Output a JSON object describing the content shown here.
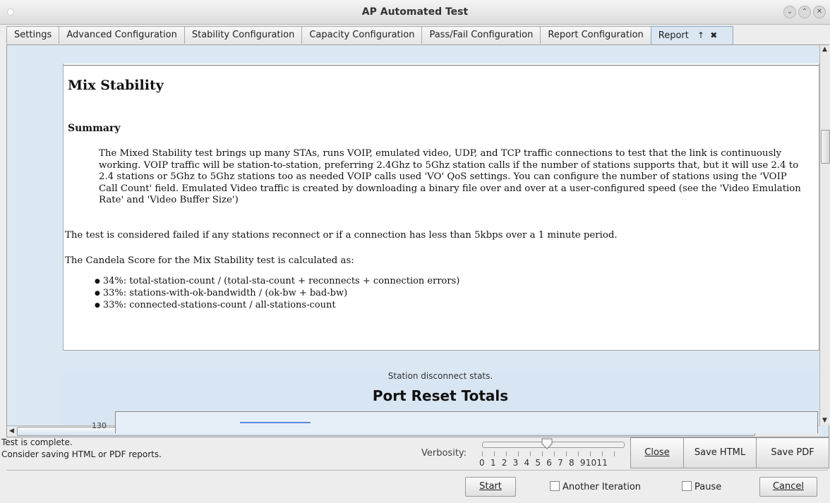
{
  "window": {
    "title": "AP Automated Test"
  },
  "tabs": [
    {
      "label": "Settings"
    },
    {
      "label": "Advanced Configuration"
    },
    {
      "label": "Stability Configuration"
    },
    {
      "label": "Capacity Configuration"
    },
    {
      "label": "Pass/Fail Configuration"
    },
    {
      "label": "Report Configuration"
    },
    {
      "label": "Report",
      "icons": [
        "up-arrow-icon",
        "close-icon"
      ]
    }
  ],
  "report": {
    "heading": "Mix Stability",
    "subheading": "Summary",
    "summary": "The Mixed Stability test brings up many STAs, runs VOIP, emulated video, UDP, and TCP traffic connections to test that the link is continuously working. VOIP traffic will be station-to-station, preferring 2.4Ghz to 5Ghz station calls if the number of stations supports that, but it will use 2.4 to 2.4 stations or 5Ghz to 5Ghz stations too as needed VOIP calls used 'VO' QoS settings. You can configure the number of stations using the 'VOIP Call Count' field. Emulated Video traffic is created by downloading a binary file over and over at a user-configured speed (see the 'Video Emulation Rate' and 'Video Buffer Size')",
    "fail_text": "The test is considered failed if any stations reconnect or if a connection has less than 5kbps over a 1 minute period.",
    "score_intro": "The Candela Score for the Mix Stability test is calculated as:",
    "score_items": [
      "34%: total-station-count / (total-sta-count + reconnects + connection errors)",
      "33%: stations-with-ok-bandwidth / (ok-bw + bad-bw)",
      "33%: connected-stations-count / all-stations-count"
    ],
    "chart_caption": "Station disconnect stats.",
    "chart_title": "Port Reset Totals",
    "chart_tick": "130"
  },
  "status": {
    "line1": "Test is complete.",
    "line2": "Consider saving HTML or PDF reports."
  },
  "verbosity": {
    "label": "Verbosity:",
    "scale": [
      "0",
      "1",
      "2",
      "3",
      "4",
      "5",
      "6",
      "7",
      "8",
      "9",
      "10",
      "11"
    ],
    "value": 5
  },
  "buttons": {
    "close": "Close",
    "save_html": "Save HTML",
    "save_pdf": "Save PDF",
    "start": "Start",
    "cancel": "Cancel"
  },
  "checkboxes": {
    "another_iteration": "Another Iteration",
    "pause": "Pause"
  }
}
